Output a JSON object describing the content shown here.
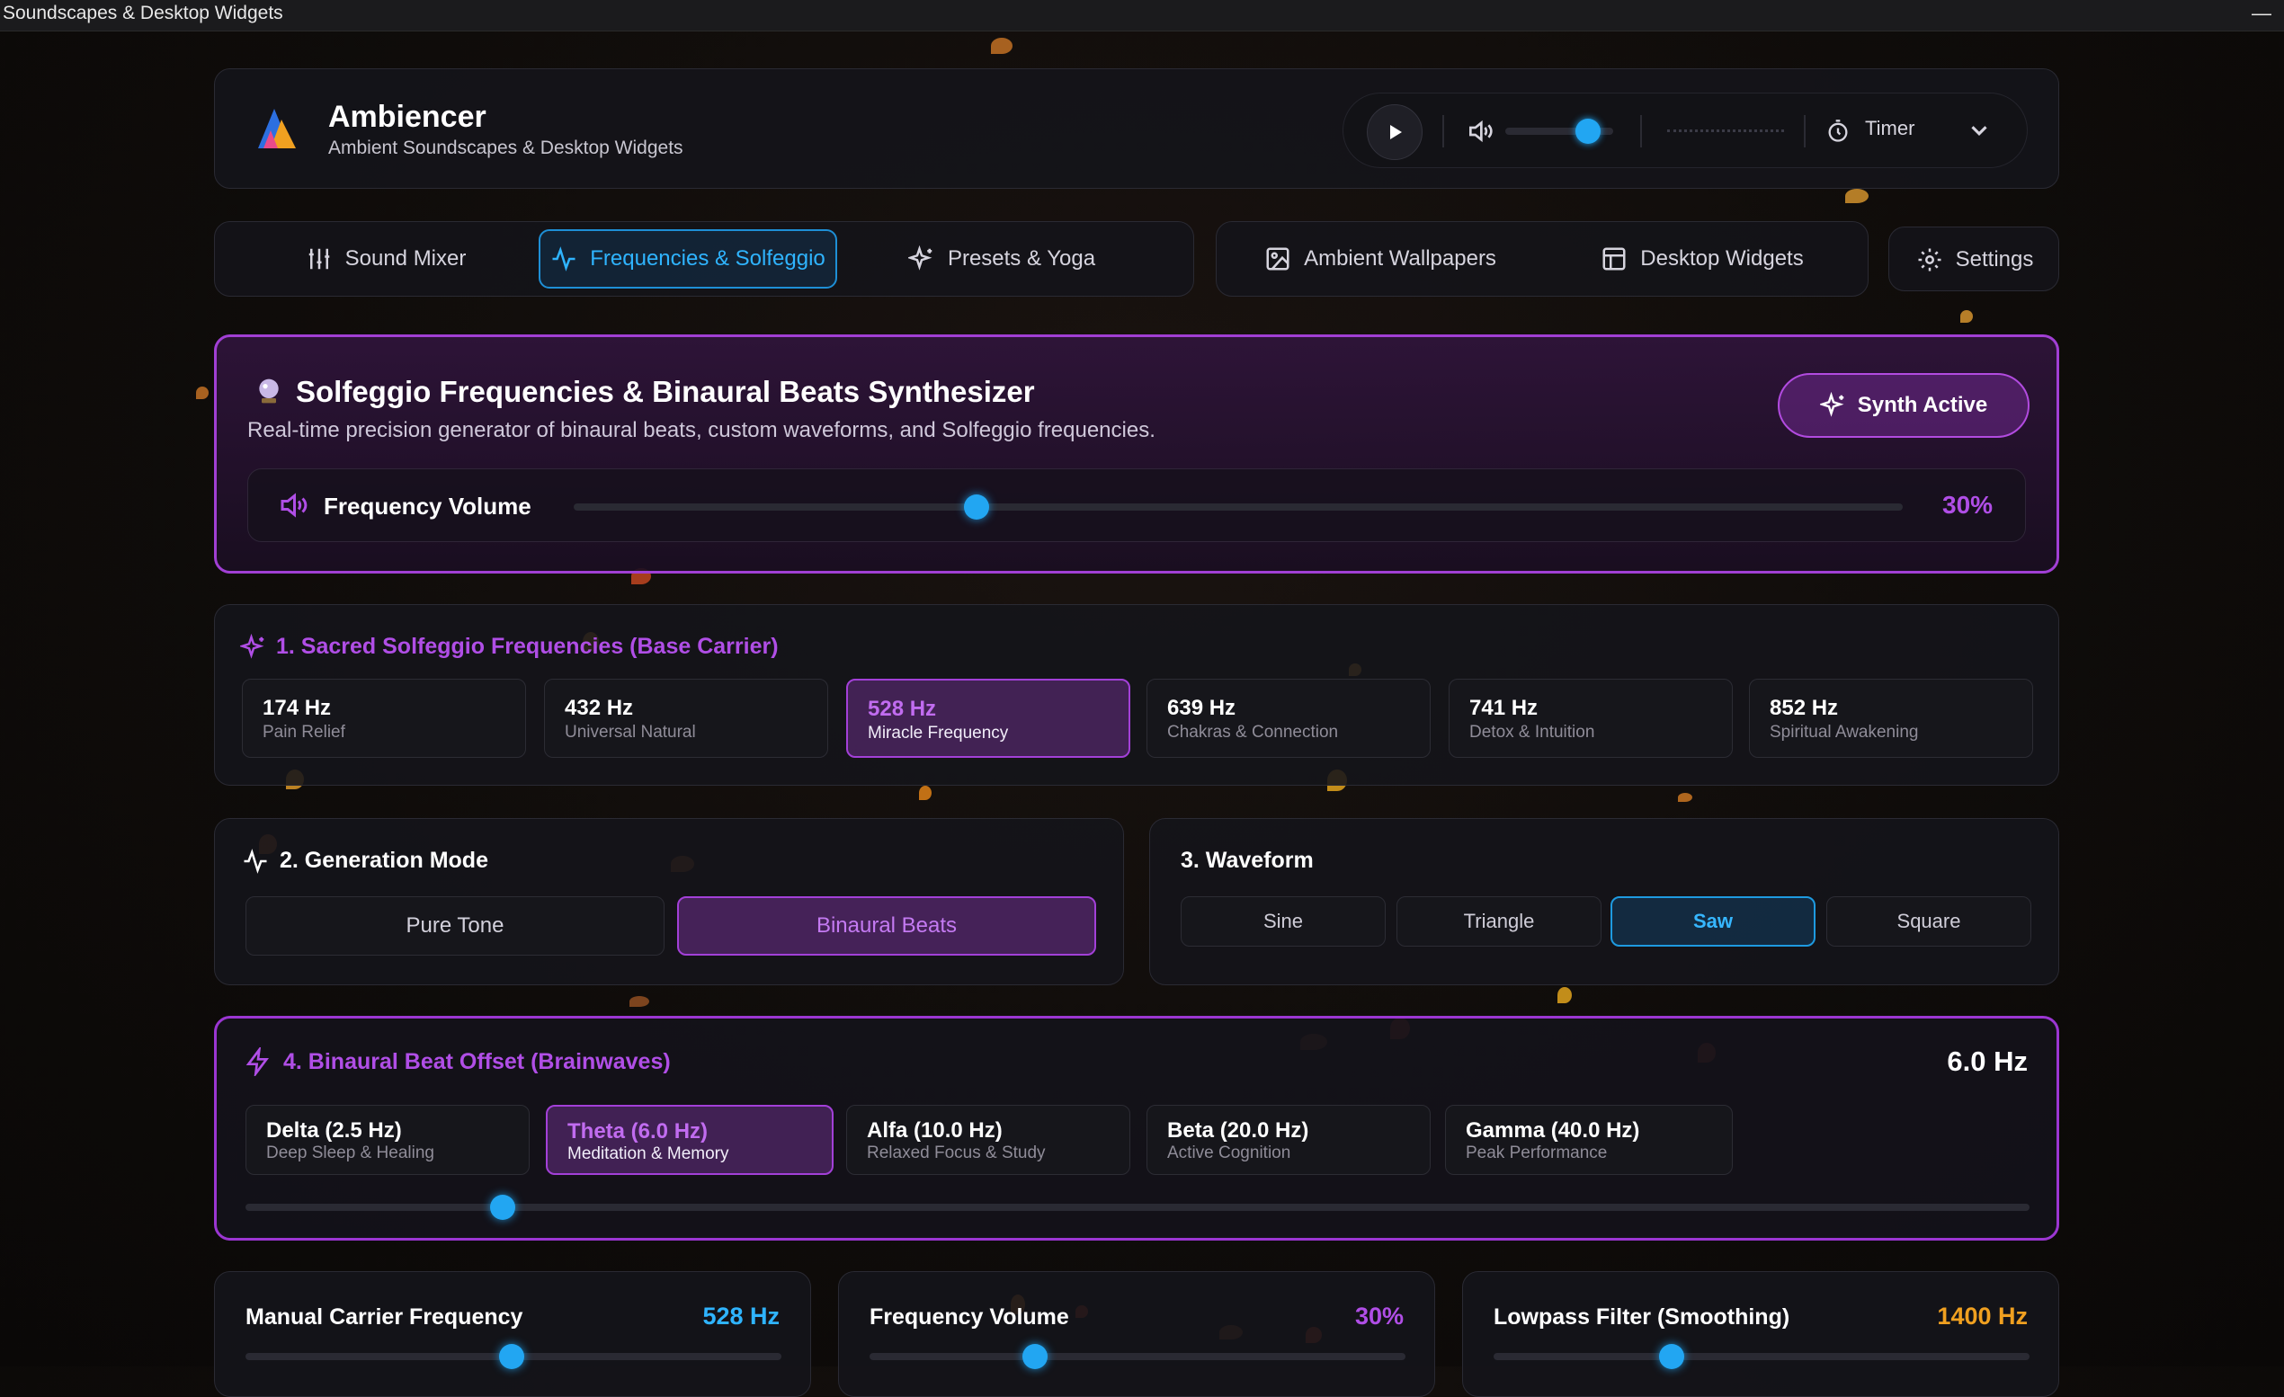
{
  "window": {
    "title": "Soundscapes & Desktop Widgets",
    "minimize": "—"
  },
  "header": {
    "app_name": "Ambiencer",
    "subtitle": "Ambient Soundscapes & Desktop Widgets",
    "player": {
      "volume": 0.7,
      "timer_label": "Timer"
    }
  },
  "nav": {
    "tabs": [
      {
        "label": "Sound Mixer",
        "icon": "sliders-icon"
      },
      {
        "label": "Frequencies & Solfeggio",
        "icon": "activity-icon",
        "active": true
      },
      {
        "label": "Presets & Yoga",
        "icon": "sparkles-icon"
      },
      {
        "label": "Ambient Wallpapers",
        "icon": "image-icon"
      },
      {
        "label": "Desktop Widgets",
        "icon": "layout-icon"
      },
      {
        "label": "Settings",
        "icon": "gear-icon"
      }
    ]
  },
  "synth": {
    "title": "Solfeggio Frequencies & Binaural Beats Synthesizer",
    "description": "Real-time precision generator of binaural beats, custom waveforms, and Solfeggio frequencies.",
    "button": "Synth Active",
    "volume_label": "Frequency Volume",
    "volume_value": "30%",
    "volume_fraction": 0.3
  },
  "solfeggio": {
    "title": "1. Sacred Solfeggio Frequencies (Base Carrier)",
    "options": [
      {
        "hz": "174 Hz",
        "desc": "Pain Relief"
      },
      {
        "hz": "432 Hz",
        "desc": "Universal Natural"
      },
      {
        "hz": "528 Hz",
        "desc": "Miracle Frequency",
        "selected": true
      },
      {
        "hz": "639 Hz",
        "desc": "Chakras & Connection"
      },
      {
        "hz": "741 Hz",
        "desc": "Detox & Intuition"
      },
      {
        "hz": "852 Hz",
        "desc": "Spiritual Awakening"
      }
    ]
  },
  "generation_mode": {
    "title": "2. Generation Mode",
    "options": [
      "Pure Tone",
      "Binaural Beats"
    ],
    "selected": "Binaural Beats"
  },
  "waveform": {
    "title": "3. Waveform",
    "options": [
      "Sine",
      "Triangle",
      "Saw",
      "Square"
    ],
    "selected": "Saw"
  },
  "binaural": {
    "title": "4. Binaural Beat Offset (Brainwaves)",
    "value": "6.0 Hz",
    "slider_fraction": 0.144,
    "options": [
      {
        "name": "Delta (2.5 Hz)",
        "desc": "Deep Sleep & Healing"
      },
      {
        "name": "Theta (6.0 Hz)",
        "desc": "Meditation & Memory",
        "selected": true
      },
      {
        "name": "Alfa (10.0 Hz)",
        "desc": "Relaxed Focus & Study"
      },
      {
        "name": "Beta (20.0 Hz)",
        "desc": "Active Cognition"
      },
      {
        "name": "Gamma (40.0 Hz)",
        "desc": "Peak Performance"
      }
    ]
  },
  "bottom": {
    "carrier": {
      "label": "Manual Carrier Frequency",
      "value": "528 Hz",
      "fraction": 0.5
    },
    "volume": {
      "label": "Frequency Volume",
      "value": "30%",
      "fraction": 0.3
    },
    "lowpass": {
      "label": "Lowpass Filter (Smoothing)",
      "value": "1400 Hz",
      "fraction": 0.33
    }
  },
  "colors": {
    "accent_purple": "#a340d8",
    "accent_blue": "#22a6f2",
    "accent_orange": "#f0a020"
  }
}
